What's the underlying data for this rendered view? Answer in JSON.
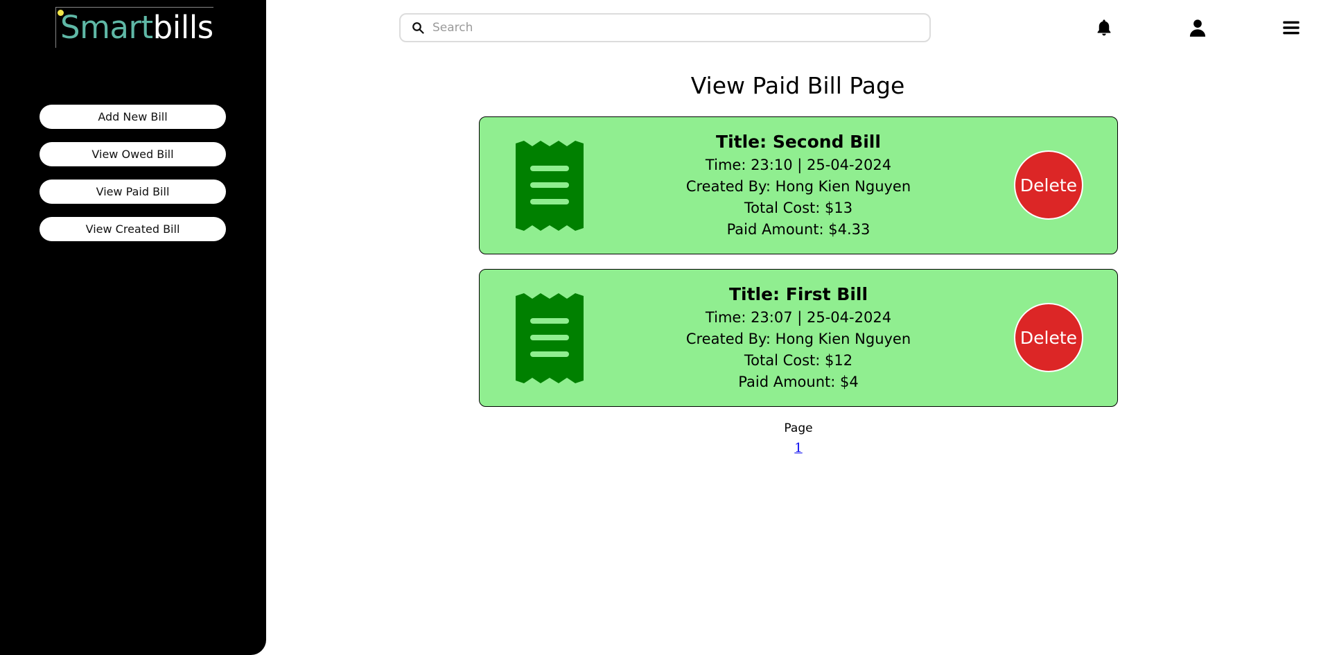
{
  "brand": {
    "part1": "Smart",
    "part2": "bills"
  },
  "sidebar": {
    "items": [
      {
        "label": "Add New Bill"
      },
      {
        "label": "View Owed Bill"
      },
      {
        "label": "View Paid Bill"
      },
      {
        "label": "View Created Bill"
      }
    ]
  },
  "header": {
    "search_placeholder": "Search",
    "icons": [
      "bell-icon",
      "user-icon",
      "menu-icon"
    ]
  },
  "main": {
    "title": "View Paid Bill Page",
    "bills": [
      {
        "title": "Title: Second Bill",
        "time": "Time: 23:10 | 25-04-2024",
        "created_by": "Created By: Hong Kien Nguyen",
        "total_cost": "Total Cost: $13",
        "paid_amount": "Paid Amount: $4.33",
        "delete_label": "Delete"
      },
      {
        "title": "Title: First Bill",
        "time": "Time: 23:07 | 25-04-2024",
        "created_by": "Created By: Hong Kien Nguyen",
        "total_cost": "Total Cost: $12",
        "paid_amount": "Paid Amount: $4",
        "delete_label": "Delete"
      }
    ],
    "pagination": {
      "label": "Page",
      "pages": [
        "1"
      ]
    }
  },
  "colors": {
    "sidebar": "#000000",
    "card_bg": "#90ee90",
    "receipt_icon": "#008000",
    "delete_button": "#dc2626",
    "brand_accent": "#5fb8a6"
  }
}
